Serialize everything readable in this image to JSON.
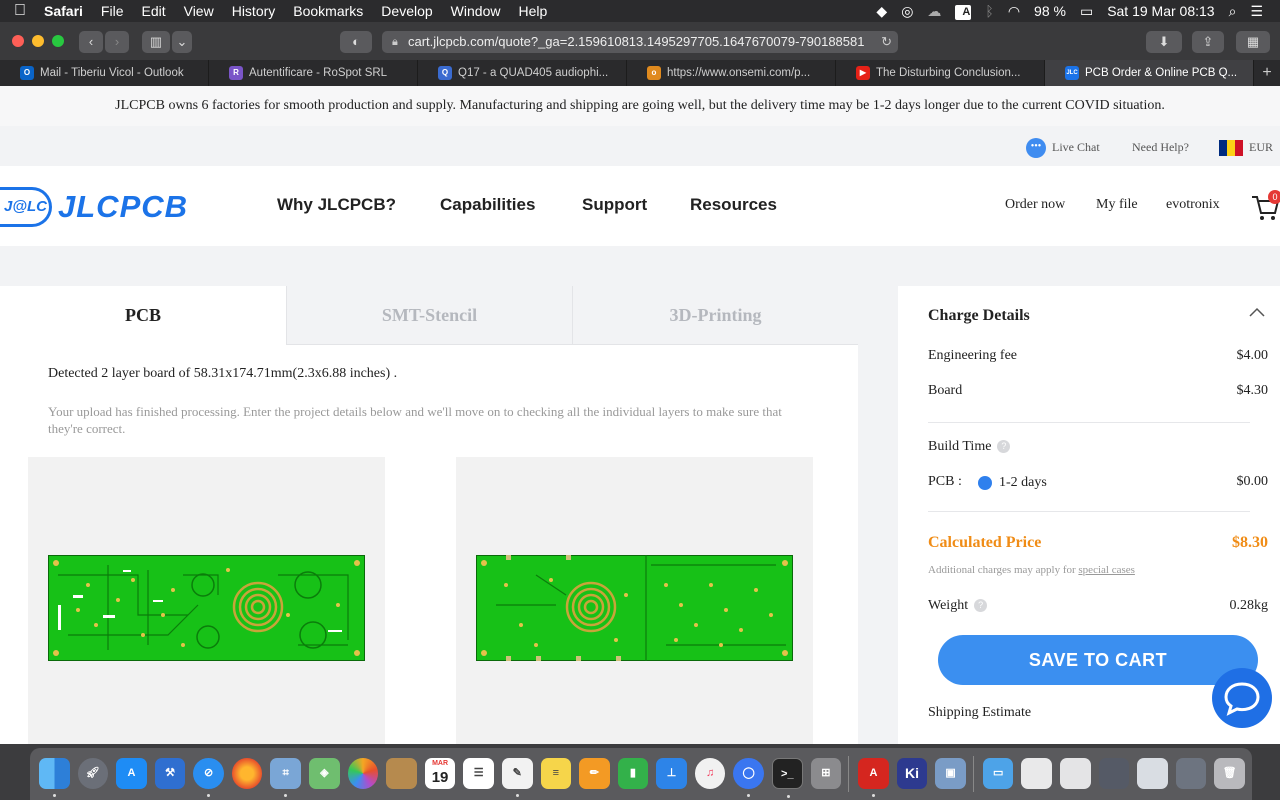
{
  "menubar": {
    "app": "Safari",
    "items": [
      "File",
      "Edit",
      "View",
      "History",
      "Bookmarks",
      "Develop",
      "Window",
      "Help"
    ],
    "battery": "98 %",
    "datetime": "Sat 19 Mar  08:13",
    "input_source": "A"
  },
  "browser": {
    "url": "cart.jlcpcb.com/quote?_ga=2.159610813.1495297705.1647670079-790188581",
    "tabs": [
      {
        "title": "Mail - Tiberiu Vicol - Outlook",
        "color": "#0a64c8",
        "fav": "O"
      },
      {
        "title": "Autentificare - RoSpot SRL",
        "color": "#7a55c8",
        "fav": "R"
      },
      {
        "title": "Q17 - a QUAD405 audiophi...",
        "color": "#3a6bd0",
        "fav": "Q"
      },
      {
        "title": "https://www.onsemi.com/p...",
        "color": "#e08a1e",
        "fav": "o"
      },
      {
        "title": "The Disturbing Conclusion...",
        "color": "#e62117",
        "fav": "▶"
      },
      {
        "title": "PCB Order & Online PCB Q...",
        "color": "#1b73e8",
        "fav": "JLC"
      }
    ]
  },
  "notice": "JLCPCB owns 6 factories for smooth production and supply. Manufacturing and shipping are going well, but the delivery time may be 1-2 days longer due to the current COVID situation.",
  "util": {
    "live_chat": "Live Chat",
    "help": "Need Help?",
    "currency": "EUR"
  },
  "header": {
    "logo_mark": "J@LC",
    "logo_text": "JLCPCB",
    "nav": [
      "Why JLCPCB?",
      "Capabilities",
      "Support",
      "Resources"
    ],
    "right": [
      "Order now",
      "My file",
      "evotronix"
    ],
    "cart_count": "0"
  },
  "product_tabs": [
    "PCB",
    "SMT-Stencil",
    "3D-Printing"
  ],
  "upload": {
    "detected": "Detected 2 layer board of 58.31x174.71mm(2.3x6.88 inches) .",
    "message": "Your upload has finished processing. Enter the project details below and we'll move on to checking all the individual layers to make sure that they're correct."
  },
  "charges": {
    "title": "Charge Details",
    "engineering_label": "Engineering fee",
    "engineering_value": "$4.00",
    "board_label": "Board",
    "board_value": "$4.30",
    "build_time_label": "Build Time",
    "pcb_label": "PCB :",
    "pcb_option": "1-2 days",
    "pcb_value": "$0.00",
    "calc_label": "Calculated Price",
    "calc_value": "$8.30",
    "additional_prefix": "Additional charges may apply for",
    "additional_link": "special cases",
    "weight_label": "Weight",
    "weight_value": "0.28kg",
    "save_button": "SAVE TO CART",
    "shipping_label": "Shipping Estimate"
  },
  "dock": {
    "calendar_month": "MAR",
    "calendar_day": "19",
    "apps": [
      "finder-icon",
      "launchpad-icon",
      "app-store-icon",
      "xcode-icon",
      "safari-icon",
      "firefox-icon",
      "preview-icon",
      "maps-icon",
      "photos-icon",
      "notes-icon",
      "calendar-icon",
      "reminders-icon",
      "textedit-icon",
      "stickies-icon",
      "pages-icon",
      "numbers-icon",
      "keynote-icon",
      "music-icon",
      "signal-icon",
      "terminal-icon",
      "calculator-icon",
      "acrobat-icon",
      "kicad-icon",
      "image-capture-icon"
    ]
  },
  "colors": {
    "accent": "#3b8ff0",
    "price_orange": "#f08c16",
    "logo_blue": "#1b73e8",
    "pcb_green": "#17c117"
  }
}
